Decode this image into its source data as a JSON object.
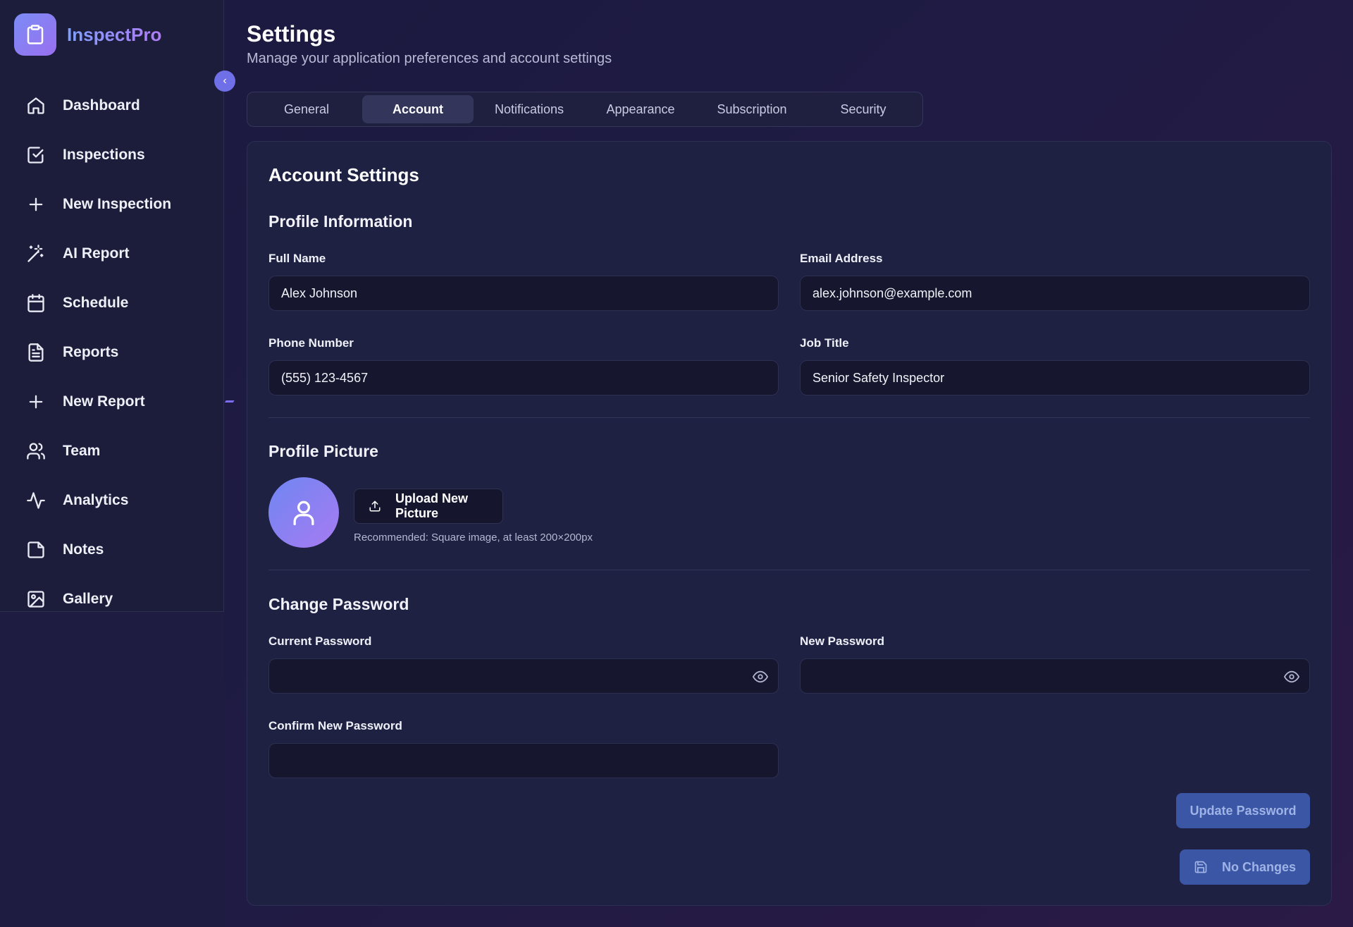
{
  "app": {
    "name": "InspectPro"
  },
  "sidebar": {
    "items": [
      {
        "label": "Dashboard",
        "icon": "home-icon"
      },
      {
        "label": "Inspections",
        "icon": "check-square-icon"
      },
      {
        "label": "New Inspection",
        "icon": "plus-icon"
      },
      {
        "label": "AI Report",
        "icon": "magic-wand-icon"
      },
      {
        "label": "Schedule",
        "icon": "calendar-icon"
      },
      {
        "label": "Reports",
        "icon": "file-text-icon"
      },
      {
        "label": "New Report",
        "icon": "plus-icon"
      },
      {
        "label": "Team",
        "icon": "users-icon"
      },
      {
        "label": "Analytics",
        "icon": "activity-icon"
      },
      {
        "label": "Notes",
        "icon": "sticky-note-icon"
      },
      {
        "label": "Gallery",
        "icon": "image-icon"
      }
    ],
    "collapse_glyph": "‹"
  },
  "header": {
    "title": "Settings",
    "subtitle": "Manage your application preferences and account settings"
  },
  "tabs": [
    {
      "label": "General"
    },
    {
      "label": "Account",
      "active": true
    },
    {
      "label": "Notifications"
    },
    {
      "label": "Appearance"
    },
    {
      "label": "Subscription"
    },
    {
      "label": "Security"
    }
  ],
  "account": {
    "title": "Account Settings",
    "profile": {
      "title": "Profile Information",
      "full_name_label": "Full Name",
      "full_name_value": "Alex Johnson",
      "email_label": "Email Address",
      "email_value": "alex.johnson@example.com",
      "phone_label": "Phone Number",
      "phone_value": "(555) 123-4567",
      "job_label": "Job Title",
      "job_value": "Senior Safety Inspector"
    },
    "picture": {
      "title": "Profile Picture",
      "upload_label": "Upload New Picture",
      "hint": "Recommended: Square image, at least 200×200px"
    },
    "password": {
      "title": "Change Password",
      "current_label": "Current Password",
      "new_label": "New Password",
      "confirm_label": "Confirm New Password",
      "update_label": "Update Password"
    },
    "save_label": "No Changes"
  },
  "colors": {
    "accent": "#7b8cf5",
    "accent2": "#a77bf1",
    "button_disabled": "#3a56a4"
  }
}
